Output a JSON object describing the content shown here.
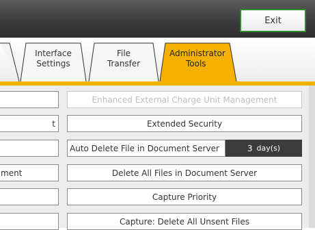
{
  "header": {
    "exit_label": "Exit"
  },
  "tabs": [
    {
      "line1": "",
      "line2": "",
      "active": false
    },
    {
      "line1": "Interface",
      "line2": "Settings",
      "active": false
    },
    {
      "line1": "File",
      "line2": "Transfer",
      "active": false
    },
    {
      "line1": "Administrator",
      "line2": "Tools",
      "active": true
    }
  ],
  "left_column": [
    {
      "label": ""
    },
    {
      "label": "t"
    },
    {
      "label": ""
    },
    {
      "label": "ment"
    },
    {
      "label": ""
    },
    {
      "label": ""
    }
  ],
  "right_column": {
    "enhanced_external": "Enhanced External Charge Unit Management",
    "extended_security": "Extended Security",
    "auto_delete_label": "Auto Delete File in Document Server",
    "auto_delete_value": "3",
    "auto_delete_unit": "day(s)",
    "delete_all_files": "Delete All Files in Document Server",
    "capture_priority": "Capture Priority",
    "capture_delete_unsent": "Capture: Delete All Unsent Files"
  },
  "colors": {
    "active_tab": "#f5b000",
    "topbar": "#3c3c3c",
    "exit_border": "#2f8a2f"
  }
}
